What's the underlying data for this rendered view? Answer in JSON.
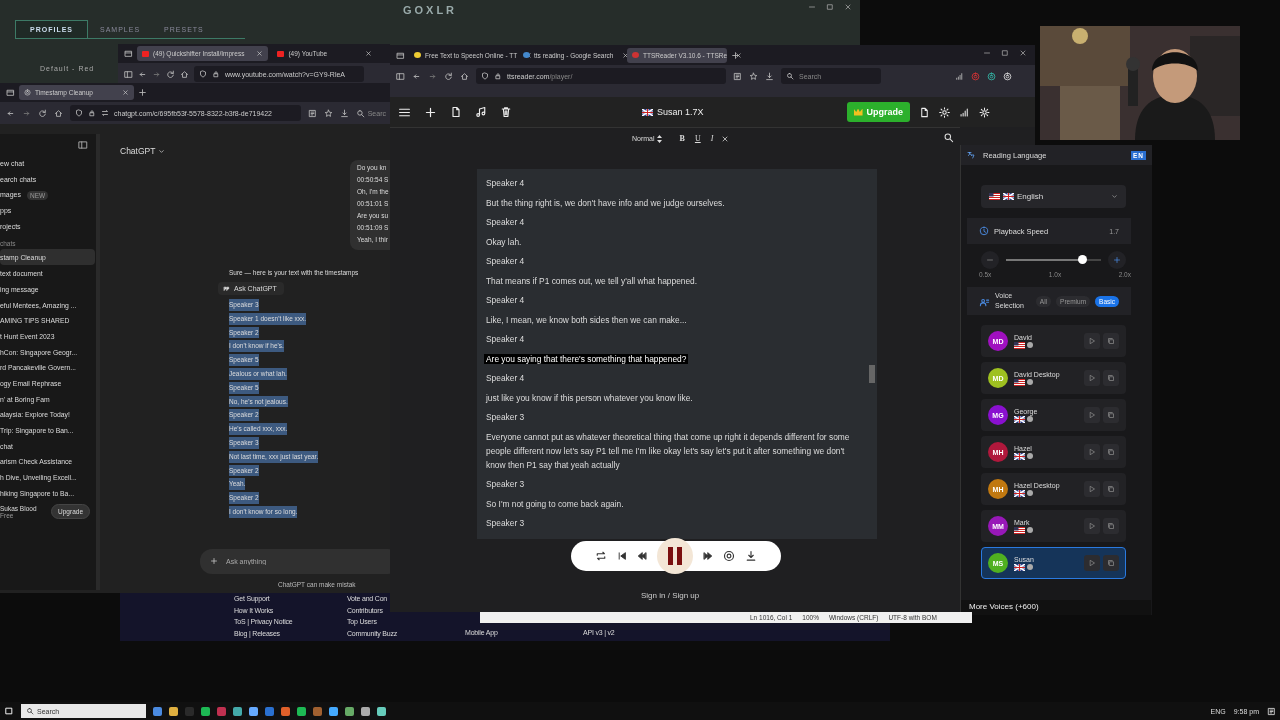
{
  "goxlr": {
    "title": "GOXLR",
    "tabs": [
      {
        "label": "PROFILES",
        "selected": true
      },
      {
        "label": "SAMPLES",
        "selected": false
      },
      {
        "label": "PRESETS",
        "selected": false
      }
    ],
    "profile": "Default - Red"
  },
  "youtube_browser": {
    "tabs": [
      {
        "label": "(49) Quickshifter Install/Impress",
        "selected": true
      },
      {
        "label": "(49) YouTube",
        "selected": false
      }
    ],
    "url": "www.youtube.com/watch?v=GY9-RleA"
  },
  "chatgpt_browser": {
    "tab": "Timestamp Cleanup",
    "url": "chatgpt.com/c/695fb53f-5578-8322-b3f8-de719422",
    "search": "Searc",
    "title": "ChatGPT",
    "nav": [
      {
        "label": "ew chat"
      },
      {
        "label": "earch chats"
      },
      {
        "label": "mages",
        "badge": "NEW"
      },
      {
        "label": "pps"
      },
      {
        "label": "rojects"
      }
    ],
    "section": "chats",
    "chats": [
      {
        "label": "stamp Cleanup",
        "selected": true
      },
      {
        "label": "text document",
        "selected": false
      },
      {
        "label": "ing message",
        "selected": false
      },
      {
        "label": "eful Mentees, Amazing ...",
        "selected": false
      },
      {
        "label": "AMING TIPS SHARED",
        "selected": false
      },
      {
        "label": "t Hunt Event 2023",
        "selected": false
      },
      {
        "label": "hCon: Singapore Geogr...",
        "selected": false
      },
      {
        "label": "rd Pancakeville Govern...",
        "selected": false
      },
      {
        "label": "ogy Email Rephrase",
        "selected": false
      },
      {
        "label": "n' at Boring Fam",
        "selected": false
      },
      {
        "label": "alaysia: Explore Today!",
        "selected": false
      },
      {
        "label": "Trip: Singapore to Ban...",
        "selected": false
      },
      {
        "label": "chat",
        "selected": false
      },
      {
        "label": "arism Check Assistance",
        "selected": false
      },
      {
        "label": "h Dive, Unveiling Excell...",
        "selected": false
      },
      {
        "label": "hiking Singapore to Ba...",
        "selected": false
      }
    ],
    "user": {
      "name": "Sukas Blood",
      "plan": "Free",
      "upgrade": "Upgrade"
    },
    "user_message": [
      "Do you kn",
      "00:50:54 S",
      "Oh, I'm the",
      "00:51:01 S",
      "Are you su",
      "00:51:09 S",
      "Yeah, I thir"
    ],
    "reply": "Sure — here is your text with the timestamps",
    "popup": "Ask ChatGPT",
    "transcript": {
      "selected": true,
      "lines": [
        "Speaker 3",
        "Speaker 1 doesn't like xxx.",
        "Speaker 2",
        "I don't know if he's.",
        "Speaker 5",
        "Jealous or what lah.",
        "Speaker 5",
        "No, he's not jealous.",
        "Speaker 2",
        "He's called xxx, xxx.",
        "Speaker 3",
        "Not last time, xxx just last year.",
        "Speaker 2",
        "Yeah.",
        "Speaker 2",
        "I don't know for so long."
      ]
    },
    "input_placeholder": "Ask anything",
    "disclaimer": "ChatGPT can make mistak"
  },
  "tts_browser": {
    "tabs": [
      {
        "label": "Free Text to Speech Online - TT",
        "selected": false
      },
      {
        "label": "tts reading - Google Search",
        "selected": false
      },
      {
        "label": "TTSReader V3.10.6 - TTSRe",
        "selected": true
      }
    ],
    "url_host": "ttsreader.com",
    "url_path": "/player/",
    "search_placeholder": "Search"
  },
  "tts": {
    "voice": "Susan 1.7X",
    "upgrade": "Upgrade",
    "format": "Normal",
    "format_buttons": [
      "B",
      "U",
      "I"
    ],
    "paragraphs": [
      {
        "speaker": "Speaker 4",
        "text": "But the thing right is, we don't have info and we judge ourselves.",
        "highlighted": false
      },
      {
        "speaker": "Speaker 4",
        "text": "Okay lah.",
        "highlighted": false
      },
      {
        "speaker": "Speaker 4",
        "text": "That means if P1 comes out, we tell y'all what happened.",
        "highlighted": false
      },
      {
        "speaker": "Speaker 4",
        "text": "Like, I mean, we know both sides then we can make...",
        "highlighted": false
      },
      {
        "speaker": "Speaker 4",
        "text": "Are you saying that there's something that happened?",
        "highlighted": true
      },
      {
        "speaker": "Speaker 4",
        "text": "just like you know if this person whatever you know like.",
        "highlighted": false
      },
      {
        "speaker": "Speaker 3",
        "text": "Everyone cannot put as whatever theoretical thing that come up right it depends different for some people different now let's say P1 tell me I'm like okay let's say let's put it after something we don't know then P1 say that yeah actually",
        "highlighted": false
      },
      {
        "speaker": "Speaker 3",
        "text": "So I'm not going to come back again.",
        "highlighted": false
      },
      {
        "speaker": "Speaker 3"
      }
    ],
    "signin": "Sign in / Sign up"
  },
  "panel": {
    "title": "Reading Language",
    "lang_badge": "EN",
    "language": "English",
    "speed_label": "Playback Speed",
    "speed_value": "1.7",
    "level": 0.8,
    "ticks": [
      "0.5x",
      "1.0x",
      "2.0x"
    ],
    "voice_label": "Voice Selection",
    "filters": [
      {
        "label": "All",
        "selected": false
      },
      {
        "label": "Premium",
        "selected": false
      },
      {
        "label": "Basic",
        "selected": true
      }
    ],
    "voices": [
      {
        "initials": "MD",
        "name": "David",
        "color": "#a010c0",
        "kind": "us",
        "selected": false
      },
      {
        "initials": "MD",
        "name": "David Desktop",
        "color": "#9ec020",
        "kind": "us",
        "selected": false
      },
      {
        "initials": "MG",
        "name": "George",
        "color": "#8a10d0",
        "kind": "uk",
        "selected": false
      },
      {
        "initials": "MH",
        "name": "Hazel",
        "color": "#b0183c",
        "kind": "uk",
        "selected": false
      },
      {
        "initials": "MH",
        "name": "Hazel Desktop",
        "color": "#c07810",
        "kind": "uk",
        "selected": false
      },
      {
        "initials": "MM",
        "name": "Mark",
        "color": "#9818b8",
        "kind": "us",
        "selected": false
      },
      {
        "initials": "MS",
        "name": "Susan",
        "color": "#50b020",
        "kind": "uk",
        "selected": true
      }
    ],
    "more": "More Voices (+600)"
  },
  "footer": {
    "columns": [
      [
        "Get Support",
        "How It Works",
        "ToS | Privacy Notice",
        "Blog | Releases"
      ],
      [
        "Vote and Con",
        "Contributors",
        "Top Users",
        "Community Buzz"
      ],
      [
        "Mobile App"
      ],
      [
        "API v3 | v2"
      ]
    ]
  },
  "notepad_status": [
    "Ln 1016, Col 1",
    "100%",
    "Windows (CRLF)",
    "UTF-8 with BOM"
  ],
  "taskbar": {
    "search": "Search",
    "language": "ENG",
    "time": "9:58 pm"
  }
}
